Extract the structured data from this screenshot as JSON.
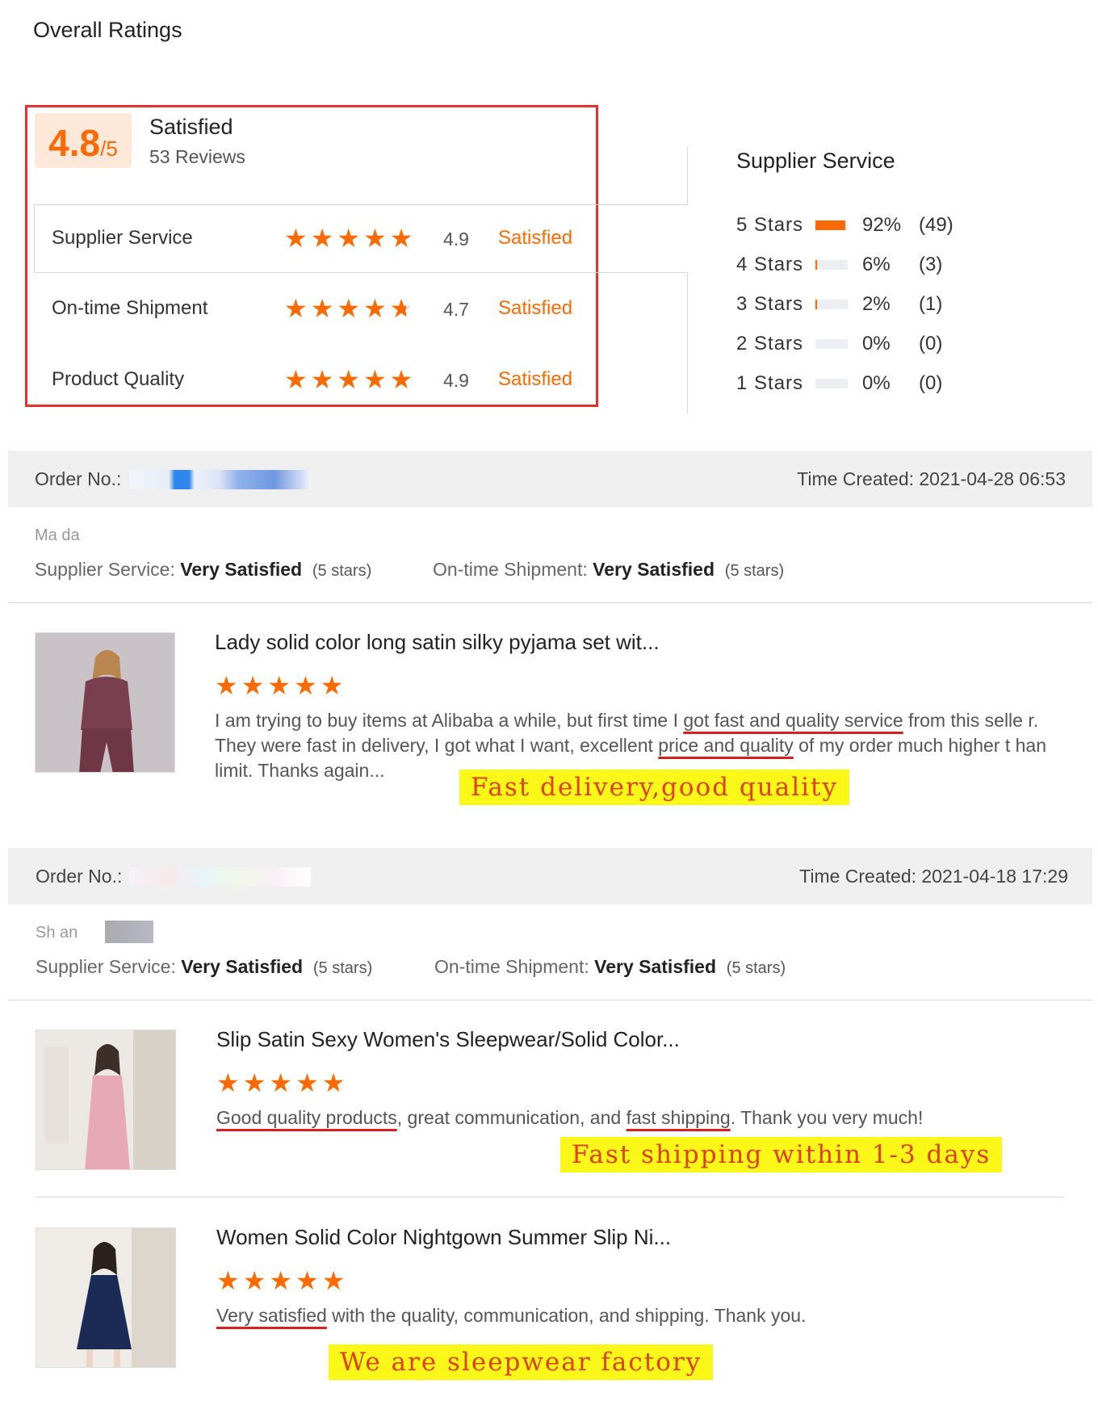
{
  "header": {
    "title": "Overall Ratings"
  },
  "summary": {
    "score": "4.8",
    "score_suffix": "/5",
    "label": "Satisfied",
    "reviews": "53 Reviews",
    "rows": [
      {
        "name": "Supplier Service",
        "score": "4.9",
        "status": "Satisfied",
        "stars": 4.9
      },
      {
        "name": "On-time Shipment",
        "score": "4.7",
        "status": "Satisfied",
        "stars": 4.7
      },
      {
        "name": "Product Quality",
        "score": "4.9",
        "status": "Satisfied",
        "stars": 4.9
      }
    ]
  },
  "distribution": {
    "title": "Supplier Service",
    "rows": [
      {
        "label": "5 Stars",
        "pct": "92%",
        "count": "(49)",
        "fraction": 0.92
      },
      {
        "label": "4 Stars",
        "pct": "6%",
        "count": "(3)",
        "fraction": 0.06
      },
      {
        "label": "3 Stars",
        "pct": "2%",
        "count": "(1)",
        "fraction": 0.02
      },
      {
        "label": "2 Stars",
        "pct": "0%",
        "count": "(0)",
        "fraction": 0
      },
      {
        "label": "1 Stars",
        "pct": "0%",
        "count": "(0)",
        "fraction": 0
      }
    ]
  },
  "orders": [
    {
      "order_label": "Order No.:",
      "time": "Time Created: 2021-04-28 06:53",
      "buyer": "Ma  da",
      "supplier_label": "Supplier Service:",
      "supplier_value": "Very Satisfied",
      "supplier_stars": "(5 stars)",
      "shipment_label": "On-time Shipment:",
      "shipment_value": "Very Satisfied",
      "shipment_stars": "(5 stars)",
      "products": [
        {
          "title": "Lady solid color long satin silky pyjama set wit...",
          "review_parts": [
            "I am trying to buy items at Alibaba a while, but first time I ",
            "got fast and quality service",
            " from this selle r. They were fast in delivery, I got what I want, excellent ",
            "price and quality",
            " of my order much higher t han limit. Thanks again..."
          ],
          "highlight": "Fast delivery,good quality"
        }
      ]
    },
    {
      "order_label": "Order No.:",
      "time": "Time Created: 2021-04-18 17:29",
      "buyer": "Sh  an",
      "supplier_label": "Supplier Service:",
      "supplier_value": "Very Satisfied",
      "supplier_stars": "(5 stars)",
      "shipment_label": "On-time Shipment:",
      "shipment_value": "Very Satisfied",
      "shipment_stars": "(5 stars)",
      "products": [
        {
          "title": "Slip Satin Sexy Women's Sleepwear/Solid Color...",
          "review_parts": [
            "Good quality products",
            ", great communication, and ",
            "fast shipping",
            ". Thank you very much!"
          ],
          "highlight": "Fast shipping within 1-3 days"
        },
        {
          "title": "Women Solid Color Nightgown Summer Slip Ni...",
          "review_parts": [
            "Very satisfied",
            " with the quality, communication, and shipping. Thank you."
          ],
          "highlight": "We are sleepwear factory"
        }
      ]
    }
  ],
  "colors": {
    "accent": "#ff6a00",
    "frame": "#e8302f",
    "highlight": "#fbf719",
    "underline": "#d71f1f"
  },
  "icons": {
    "star": "star-icon"
  }
}
